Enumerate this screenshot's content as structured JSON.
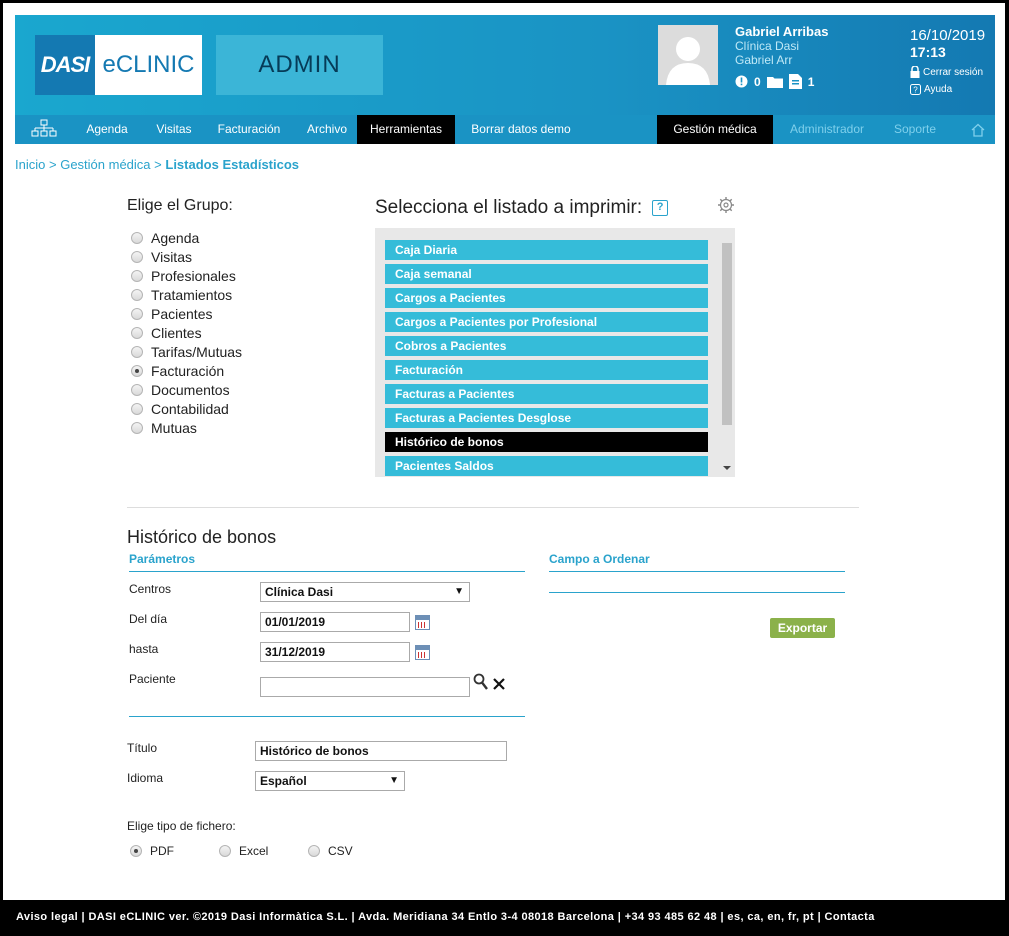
{
  "header": {
    "logo_left": "DASI",
    "logo_right": "eCLINIC",
    "module": "ADMIN",
    "user_name": "Gabriel Arribas",
    "clinic": "Clínica Dasi",
    "user_short": "Gabriel Arr",
    "alerts_count": "0",
    "docs_count": "1",
    "date": "16/10/2019",
    "time": "17:13",
    "logout": "Cerrar sesión",
    "help": "Ayuda"
  },
  "nav": {
    "items": [
      "Agenda",
      "Visitas",
      "Facturación",
      "Archivo",
      "Herramientas",
      "Borrar datos demo"
    ],
    "right": [
      "Gestión médica",
      "Administrador",
      "Soporte"
    ]
  },
  "breadcrumb": {
    "home": "Inicio",
    "sep1": ">",
    "section": "Gestión médica",
    "sep2": ">",
    "current": "Listados Estadísticos"
  },
  "group": {
    "title": "Elige el Grupo:",
    "options": [
      "Agenda",
      "Visitas",
      "Profesionales",
      "Tratamientos",
      "Pacientes",
      "Clientes",
      "Tarifas/Mutuas",
      "Facturación",
      "Documentos",
      "Contabilidad",
      "Mutuas"
    ],
    "selected": "Facturación"
  },
  "listing": {
    "title": "Selecciona el listado a imprimir:",
    "help": "?",
    "items": [
      "Caja Diaria",
      "Caja semanal",
      "Cargos a Pacientes",
      "Cargos a Pacientes por Profesional",
      "Cobros a Pacientes",
      "Facturación",
      "Facturas a Pacientes",
      "Facturas a Pacientes Desglose",
      "Histórico de bonos",
      "Pacientes Saldos"
    ],
    "selected": "Histórico de bonos"
  },
  "report": {
    "title": "Histórico de bonos",
    "params_title": "Parámetros",
    "order_title": "Campo a Ordenar",
    "centros_label": "Centros",
    "centros_value": "Clínica Dasi",
    "from_label": "Del día",
    "from_value": "01/01/2019",
    "to_label": "hasta",
    "to_value": "31/12/2019",
    "patient_label": "Paciente",
    "patient_value": "",
    "export_label": "Exportar",
    "titulo_label": "Título",
    "titulo_value": "Histórico de bonos",
    "idioma_label": "Idioma",
    "idioma_value": "Español",
    "filetype_label": "Elige tipo de fichero:",
    "filetypes": [
      "PDF",
      "Excel",
      "CSV"
    ],
    "filetype_selected": "PDF"
  },
  "footer": {
    "text": "Aviso legal | DASI eCLINIC ver. ©2019 Dasi Informàtica S.L. | Avda. Meridiana 34 Entlo 3-4 08018 Barcelona | +34 93 485 62 48 | es, ca, en, fr, pt | Contacta"
  },
  "colors": {
    "brand": "#1a93c4",
    "list_item": "#35bcd9",
    "accent": "#2aa3cc",
    "export": "#8bb14a"
  }
}
